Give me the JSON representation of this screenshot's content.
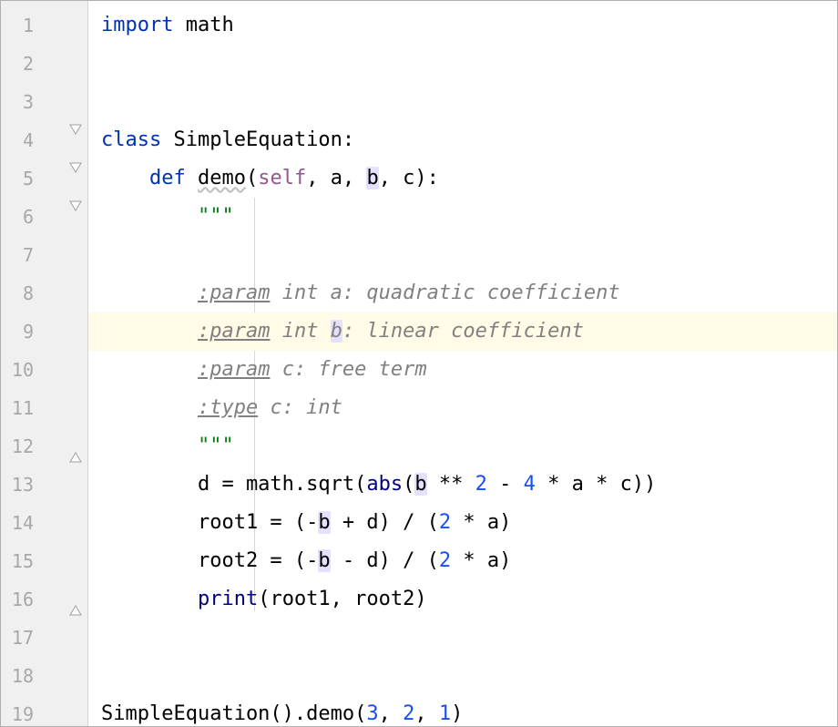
{
  "lineCount": 19,
  "highlightedLine": 9,
  "foldMarkers": [
    {
      "line": 4,
      "type": "open"
    },
    {
      "line": 5,
      "type": "open"
    },
    {
      "line": 6,
      "type": "open"
    },
    {
      "line": 12,
      "type": "close"
    },
    {
      "line": 16,
      "type": "close"
    }
  ],
  "indentGuide": {
    "fromLine": 6,
    "toLine": 16
  },
  "code": {
    "l1": [
      {
        "t": "kw",
        "v": "import"
      },
      {
        "t": "plain",
        "v": " math"
      }
    ],
    "l2": [],
    "l3": [],
    "l4": [
      {
        "t": "kw",
        "v": "class"
      },
      {
        "t": "plain",
        "v": " SimpleEquation:"
      }
    ],
    "l5": [
      {
        "t": "plain",
        "v": "    "
      },
      {
        "t": "kw",
        "v": "def"
      },
      {
        "t": "plain",
        "v": " "
      },
      {
        "t": "fn wavy",
        "v": "demo"
      },
      {
        "t": "plain",
        "v": "("
      },
      {
        "t": "self",
        "v": "self"
      },
      {
        "t": "plain",
        "v": ", a, "
      },
      {
        "t": "plain occ",
        "v": "b"
      },
      {
        "t": "plain",
        "v": ", c):"
      }
    ],
    "l6": [
      {
        "t": "plain",
        "v": "        "
      },
      {
        "t": "str",
        "v": "\"\"\""
      }
    ],
    "l7": [],
    "l8": [
      {
        "t": "plain",
        "v": "        "
      },
      {
        "t": "doctag",
        "v": ":param"
      },
      {
        "t": "doc",
        "v": " int a: quadratic coefficient"
      }
    ],
    "l9": [
      {
        "t": "plain",
        "v": "        "
      },
      {
        "t": "doctag",
        "v": ":param"
      },
      {
        "t": "doc",
        "v": " int "
      },
      {
        "t": "doc occ",
        "v": "b"
      },
      {
        "t": "doc",
        "v": ": linear coefficient"
      }
    ],
    "l10": [
      {
        "t": "plain",
        "v": "        "
      },
      {
        "t": "doctag",
        "v": ":param"
      },
      {
        "t": "doc",
        "v": " c: free term"
      }
    ],
    "l11": [
      {
        "t": "plain",
        "v": "        "
      },
      {
        "t": "doctag",
        "v": ":type"
      },
      {
        "t": "doc",
        "v": " c: int"
      }
    ],
    "l12": [
      {
        "t": "plain",
        "v": "        "
      },
      {
        "t": "str",
        "v": "\"\"\""
      }
    ],
    "l13": [
      {
        "t": "plain",
        "v": "        d = math.sqrt("
      },
      {
        "t": "builtin",
        "v": "abs"
      },
      {
        "t": "plain",
        "v": "("
      },
      {
        "t": "plain occ",
        "v": "b"
      },
      {
        "t": "plain",
        "v": " ** "
      },
      {
        "t": "num",
        "v": "2"
      },
      {
        "t": "plain",
        "v": " - "
      },
      {
        "t": "num",
        "v": "4"
      },
      {
        "t": "plain",
        "v": " * a * c))"
      }
    ],
    "l14": [
      {
        "t": "plain",
        "v": "        root1 = (-"
      },
      {
        "t": "plain occ",
        "v": "b"
      },
      {
        "t": "plain",
        "v": " + d) / ("
      },
      {
        "t": "num",
        "v": "2"
      },
      {
        "t": "plain",
        "v": " * a)"
      }
    ],
    "l15": [
      {
        "t": "plain",
        "v": "        root2 = (-"
      },
      {
        "t": "plain occ",
        "v": "b"
      },
      {
        "t": "plain",
        "v": " - d) / ("
      },
      {
        "t": "num",
        "v": "2"
      },
      {
        "t": "plain",
        "v": " * a)"
      }
    ],
    "l16": [
      {
        "t": "plain",
        "v": "        "
      },
      {
        "t": "builtin",
        "v": "print"
      },
      {
        "t": "plain",
        "v": "(root1, root2)"
      }
    ],
    "l17": [],
    "l18": [],
    "l19": [
      {
        "t": "plain",
        "v": "SimpleEquation().demo("
      },
      {
        "t": "num",
        "v": "3"
      },
      {
        "t": "plain",
        "v": ", "
      },
      {
        "t": "num",
        "v": "2"
      },
      {
        "t": "plain",
        "v": ", "
      },
      {
        "t": "num",
        "v": "1"
      },
      {
        "t": "plain",
        "v": ")"
      }
    ]
  }
}
